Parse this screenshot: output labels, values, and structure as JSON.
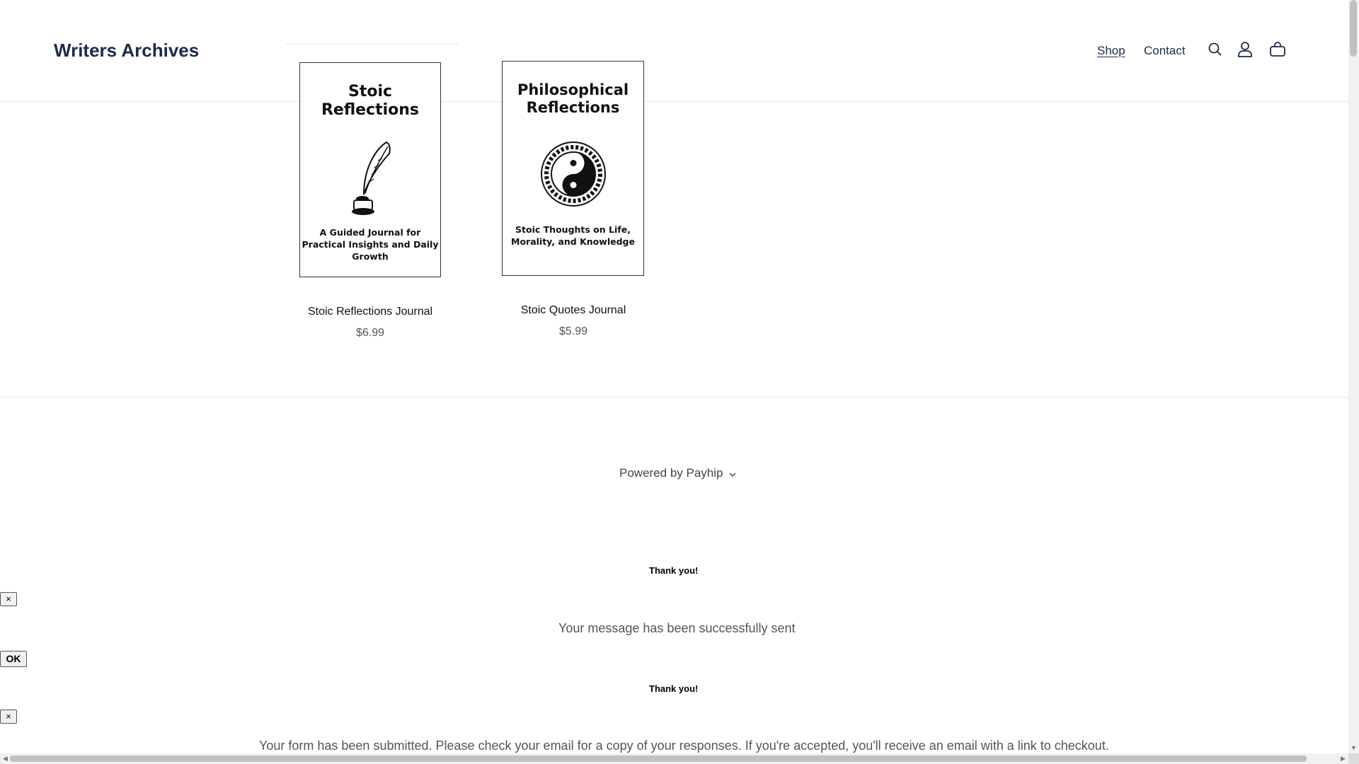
{
  "header": {
    "brand": "Writers Archives",
    "nav": {
      "shop": "Shop",
      "contact": "Contact"
    },
    "icons": [
      "search-icon",
      "account-icon",
      "cart-icon"
    ]
  },
  "products": [
    {
      "cover_title_line1": "Stoic",
      "cover_title_line2": "Reflections",
      "cover_subtitle_line1": "A Guided Journal for",
      "cover_subtitle_line2": "Practical Insights and Daily",
      "cover_subtitle_line3": "Growth",
      "cover_icon": "quill-and-inkwell-icon",
      "name": "Stoic Reflections Journal",
      "price": "$6.99"
    },
    {
      "cover_title_line1": "Philosophical",
      "cover_title_line2": "Reflections",
      "cover_subtitle_line1": "Stoic Thoughts on Life,",
      "cover_subtitle_line2": "Morality, and Knowledge",
      "cover_icon": "yin-yang-icon",
      "name": "Stoic Quotes Journal",
      "price": "$5.99"
    }
  ],
  "footer": {
    "powered_by": "Powered by Payhip"
  },
  "modals": {
    "first": {
      "title": "Thank you!",
      "close_label": "×",
      "message": "Your message has been successfully sent",
      "ok_label": "OK"
    },
    "second": {
      "title": "Thank you!",
      "close_label": "×",
      "message": "Your form has been submitted. Please check your email for a copy of your responses. If you're accepted, you'll receive an email with a link to checkout."
    }
  },
  "colors": {
    "brand": "#1c2a4a",
    "text": "#1a1a1a",
    "muted": "#555555",
    "divider": "#e6e6e6"
  }
}
